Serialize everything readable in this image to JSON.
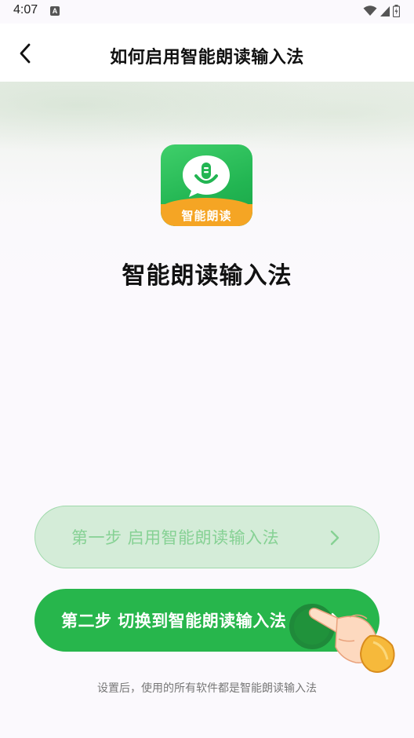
{
  "status_bar": {
    "time": "4:07",
    "notification_icon": "A"
  },
  "app_bar": {
    "title": "如何启用智能朗读输入法",
    "back_icon": "chevron-left-icon"
  },
  "app_icon": {
    "label": "智能朗读",
    "colors": {
      "green": "#27b64c",
      "orange": "#f5a524"
    }
  },
  "app_name": "智能朗读输入法",
  "steps": [
    {
      "label": "第一步  启用智能朗读输入法",
      "state": "disabled",
      "icon": "chevron-right-icon"
    },
    {
      "label": "第二步  切换到智能朗读输入法",
      "state": "active",
      "icon": "chevron-right-icon"
    }
  ],
  "footnote": "设置后，使用的所有软件都是智能朗读输入法",
  "accent_color": "#27b64c"
}
